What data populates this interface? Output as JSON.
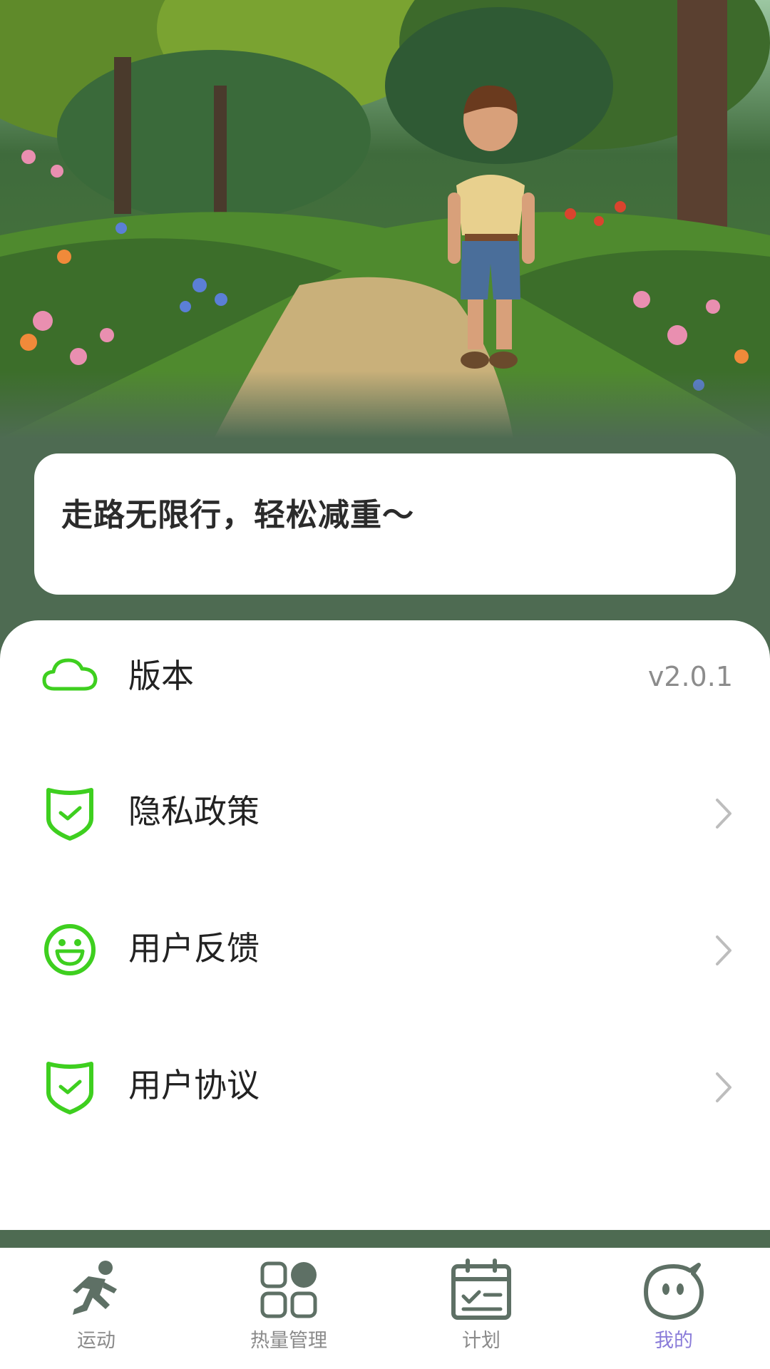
{
  "slogan": "走路无限行，轻松减重～",
  "menu": {
    "items": [
      {
        "id": "version",
        "label": "版本",
        "value": "v2.0.1",
        "icon": "cloud-icon"
      },
      {
        "id": "privacy",
        "label": "隐私政策",
        "icon": "shield-check-icon"
      },
      {
        "id": "feedback",
        "label": "用户反馈",
        "icon": "smile-icon"
      },
      {
        "id": "agreement",
        "label": "用户协议",
        "icon": "shield-check-icon"
      }
    ]
  },
  "nav": {
    "items": [
      {
        "label": "运动",
        "icon": "running-icon",
        "active": false
      },
      {
        "label": "热量管理",
        "icon": "grid-icon",
        "active": false
      },
      {
        "label": "计划",
        "icon": "calendar-check-icon",
        "active": false
      },
      {
        "label": "我的",
        "icon": "chat-face-icon",
        "active": true
      }
    ]
  },
  "colors": {
    "accent_green": "#3ecf1f",
    "page_bg": "#4e6b52",
    "nav_active": "#8a7cd9",
    "nav_inactive": "#8a8a8a",
    "nav_icon": "#5e7065"
  }
}
